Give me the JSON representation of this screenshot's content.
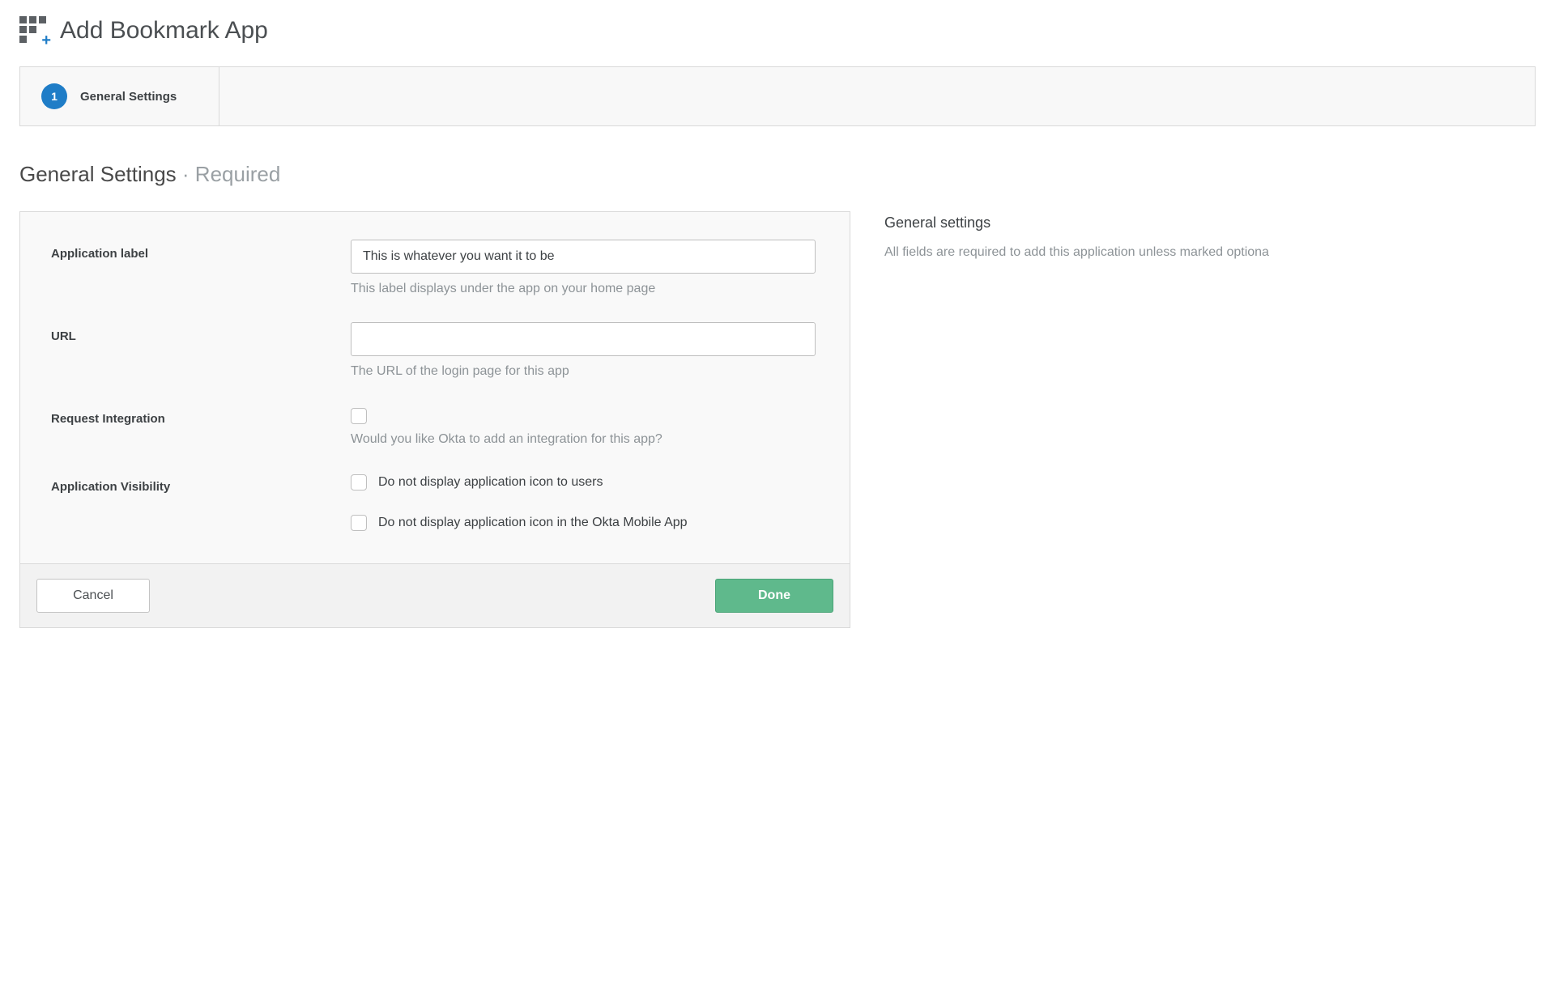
{
  "page": {
    "title": "Add Bookmark App"
  },
  "wizard": {
    "steps": [
      {
        "number": "1",
        "label": "General Settings"
      }
    ]
  },
  "section": {
    "title": "General Settings",
    "subtitle": "· Required"
  },
  "form": {
    "fields": {
      "app_label": {
        "label": "Application label",
        "value": "This is whatever you want it to be",
        "hint": "This label displays under the app on your home page"
      },
      "url": {
        "label": "URL",
        "value": "",
        "hint": "The URL of the login page for this app"
      },
      "request_integration": {
        "label": "Request Integration",
        "hint": "Would you like Okta to add an integration for this app?"
      },
      "visibility": {
        "label": "Application Visibility",
        "options": [
          "Do not display application icon to users",
          "Do not display application icon in the Okta Mobile App"
        ]
      }
    },
    "buttons": {
      "cancel": "Cancel",
      "done": "Done"
    }
  },
  "sidebar": {
    "title": "General settings",
    "text": "All fields are required to add this application unless marked optiona"
  }
}
